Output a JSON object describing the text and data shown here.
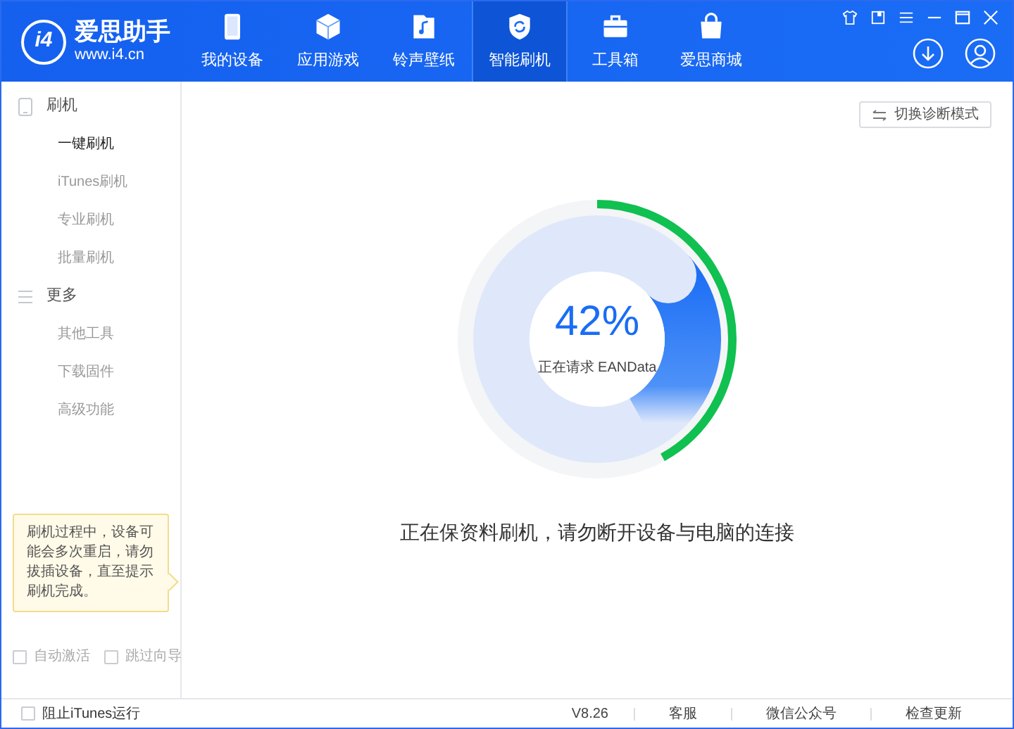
{
  "app": {
    "logo_mark": "i4",
    "name": "爱思助手",
    "url": "www.i4.cn"
  },
  "nav": [
    {
      "label": "我的设备",
      "selected": false
    },
    {
      "label": "应用游戏",
      "selected": false
    },
    {
      "label": "铃声壁纸",
      "selected": false
    },
    {
      "label": "智能刷机",
      "selected": true
    },
    {
      "label": "工具箱",
      "selected": false
    },
    {
      "label": "爱思商城",
      "selected": false
    }
  ],
  "sidebar": [
    {
      "label": "刷机",
      "children": [
        {
          "label": "一键刷机",
          "selected": true
        },
        {
          "label": "iTunes刷机",
          "selected": false
        },
        {
          "label": "专业刷机",
          "selected": false
        },
        {
          "label": "批量刷机",
          "selected": false
        }
      ]
    },
    {
      "label": "更多",
      "children": [
        {
          "label": "其他工具",
          "selected": false
        },
        {
          "label": "下载固件",
          "selected": false
        },
        {
          "label": "高级功能",
          "selected": false
        }
      ]
    }
  ],
  "tip": "刷机过程中，设备可能会多次重启，请勿拔插设备，直至提示刷机完成。",
  "options": [
    {
      "label": "自动激活",
      "checked": false
    },
    {
      "label": "跳过向导",
      "checked": false
    }
  ],
  "mode_button": "切换诊断模式",
  "flash": {
    "percent": "42%",
    "status": "正在请求 EANData",
    "level": 0.42,
    "message": "正在保资料刷机，请勿断开设备与电脑的连接"
  },
  "footer": {
    "block_itunes": {
      "label": "阻止iTunes运行",
      "checked": false
    },
    "version": "V8.26",
    "links": [
      "客服",
      "微信公众号",
      "检查更新"
    ]
  }
}
